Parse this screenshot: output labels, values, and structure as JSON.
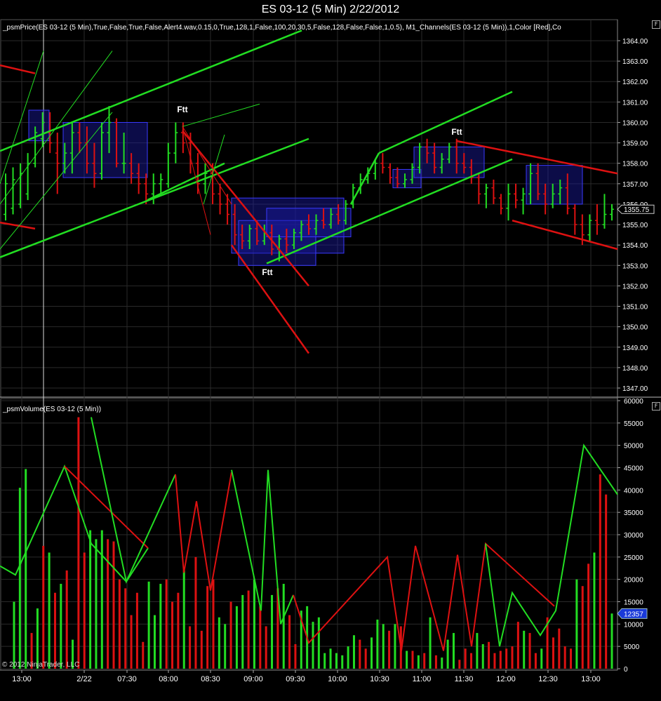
{
  "window": {
    "title": "ES 03-12 (5 Min)  2/22/2012"
  },
  "price_panel": {
    "indicator_label": "_psmPrice(ES 03-12 (5 Min),True,False,True,False,Alert4.wav,0.15,0,True,128,1,False,100,20,30,5,False,128,False,False,1,0.5), M1_Channels(ES 03-12 (5 Min)),1,Color [Red],Co",
    "f_button": "F",
    "current_price_tag": "1355.75",
    "ftt_markers": [
      {
        "text": "Ftt"
      },
      {
        "text": "Ftt"
      },
      {
        "text": "Ftt"
      }
    ]
  },
  "volume_panel": {
    "indicator_label": "_psmVolume(ES 03-12 (5 Min))",
    "f_button": "F",
    "current_volume_tag": "12357"
  },
  "copyright": "© 2012 NinjaTrader, LLC",
  "time_axis": {
    "labels": [
      "13:00",
      "2/22",
      "07:30",
      "08:00",
      "08:30",
      "09:00",
      "09:30",
      "10:00",
      "10:30",
      "11:00",
      "11:30",
      "12:00",
      "12:30",
      "13:00"
    ]
  },
  "colors": {
    "up": "#22dd22",
    "down": "#dd1111",
    "box": "#1a1aa0",
    "grid": "#2a2a2a",
    "axis_text": "#ffffff",
    "tag_blue": "#1a3ad8"
  },
  "chart_data": [
    {
      "type": "line",
      "title": "",
      "ylabel": "",
      "ylim": [
        1346.6,
        1364.4
      ],
      "y_ticks": [
        1347,
        1348,
        1349,
        1350,
        1351,
        1352,
        1353,
        1354,
        1355,
        1356,
        1357,
        1358,
        1359,
        1360,
        1361,
        1362,
        1363,
        1364
      ],
      "grid": true,
      "series": [
        {
          "values": [
            [
              1355.5,
              1357.5,
              1355.2,
              1357.0
            ],
            [
              1355.8,
              1357.8,
              1355.5,
              1357.2
            ],
            [
              1356.0,
              1358.0,
              1355.8,
              1357.5
            ],
            [
              1356.5,
              1358.5,
              1356.2,
              1358.0
            ],
            [
              1358.0,
              1359.8,
              1357.8,
              1359.5
            ],
            [
              1359.2,
              1360.5,
              1358.8,
              1360.0
            ],
            [
              1359.5,
              1360.5,
              1358.5,
              1359.0
            ],
            [
              1358.5,
              1359.5,
              1356.5,
              1358.0
            ],
            [
              1358.0,
              1359.0,
              1357.5,
              1358.5
            ],
            [
              1358.5,
              1360.0,
              1357.5,
              1359.5
            ],
            [
              1359.5,
              1360.0,
              1358.5,
              1359.0
            ],
            [
              1359.0,
              1359.8,
              1357.5,
              1358.0
            ],
            [
              1358.0,
              1359.0,
              1356.8,
              1357.5
            ],
            [
              1357.5,
              1360.0,
              1357.2,
              1359.5
            ],
            [
              1359.5,
              1360.8,
              1358.5,
              1360.0
            ],
            [
              1360.0,
              1360.2,
              1357.8,
              1358.0
            ],
            [
              1358.0,
              1359.5,
              1357.5,
              1358.0
            ],
            [
              1358.0,
              1358.5,
              1357.0,
              1357.5
            ],
            [
              1357.5,
              1358.0,
              1356.5,
              1357.0
            ],
            [
              1357.0,
              1357.5,
              1356.0,
              1356.5
            ],
            [
              1356.5,
              1357.5,
              1356.0,
              1357.0
            ],
            [
              1357.0,
              1357.5,
              1356.5,
              1357.2
            ],
            [
              1357.0,
              1359.0,
              1356.8,
              1358.5
            ],
            [
              1358.5,
              1360.0,
              1358.0,
              1359.5
            ],
            [
              1359.5,
              1360.0,
              1358.5,
              1359.0
            ],
            [
              1359.0,
              1359.5,
              1357.5,
              1358.0
            ],
            [
              1358.0,
              1358.5,
              1356.5,
              1357.0
            ],
            [
              1357.0,
              1358.0,
              1356.5,
              1357.5
            ],
            [
              1357.5,
              1358.0,
              1356.0,
              1356.5
            ],
            [
              1356.5,
              1357.0,
              1355.5,
              1356.0
            ],
            [
              1356.0,
              1356.5,
              1355.0,
              1355.5
            ],
            [
              1355.5,
              1356.0,
              1354.0,
              1354.5
            ],
            [
              1354.5,
              1355.0,
              1353.8,
              1354.2
            ],
            [
              1354.2,
              1355.0,
              1353.8,
              1354.8
            ],
            [
              1354.8,
              1355.2,
              1354.0,
              1354.2
            ],
            [
              1354.2,
              1355.0,
              1354.0,
              1354.6
            ],
            [
              1354.6,
              1355.0,
              1353.5,
              1353.8
            ],
            [
              1353.8,
              1354.5,
              1353.2,
              1354.3
            ],
            [
              1354.3,
              1354.8,
              1353.6,
              1354.0
            ],
            [
              1354.0,
              1354.8,
              1353.8,
              1354.6
            ],
            [
              1354.6,
              1355.2,
              1354.2,
              1355.0
            ],
            [
              1355.0,
              1355.5,
              1354.5,
              1354.8
            ],
            [
              1354.8,
              1355.5,
              1354.5,
              1355.2
            ],
            [
              1355.2,
              1355.8,
              1354.8,
              1355.0
            ],
            [
              1355.0,
              1355.8,
              1354.8,
              1355.5
            ],
            [
              1355.5,
              1356.0,
              1355.0,
              1355.2
            ],
            [
              1355.2,
              1356.2,
              1355.0,
              1356.0
            ],
            [
              1356.0,
              1357.0,
              1355.8,
              1356.8
            ],
            [
              1356.8,
              1357.5,
              1356.5,
              1357.2
            ],
            [
              1357.2,
              1357.8,
              1357.0,
              1357.5
            ],
            [
              1357.5,
              1358.2,
              1357.2,
              1358.0
            ],
            [
              1358.0,
              1358.5,
              1357.5,
              1357.8
            ],
            [
              1357.8,
              1358.0,
              1357.0,
              1357.3
            ],
            [
              1357.3,
              1357.8,
              1356.8,
              1357.0
            ],
            [
              1357.0,
              1357.5,
              1356.8,
              1357.2
            ],
            [
              1357.2,
              1358.0,
              1357.0,
              1357.8
            ],
            [
              1357.8,
              1359.0,
              1357.5,
              1358.8
            ],
            [
              1358.8,
              1359.2,
              1358.0,
              1358.5
            ],
            [
              1358.5,
              1359.0,
              1357.5,
              1357.8
            ],
            [
              1357.8,
              1358.5,
              1357.5,
              1358.2
            ],
            [
              1358.2,
              1359.0,
              1358.0,
              1358.8
            ],
            [
              1358.8,
              1359.2,
              1357.5,
              1358.0
            ],
            [
              1358.0,
              1358.5,
              1357.5,
              1357.8
            ],
            [
              1357.8,
              1358.2,
              1357.0,
              1357.3
            ],
            [
              1357.3,
              1357.5,
              1356.0,
              1356.5
            ],
            [
              1356.5,
              1357.0,
              1355.8,
              1356.8
            ],
            [
              1356.8,
              1357.2,
              1356.0,
              1356.3
            ],
            [
              1356.3,
              1356.5,
              1355.5,
              1355.8
            ],
            [
              1355.8,
              1357.0,
              1355.2,
              1356.5
            ],
            [
              1356.5,
              1357.0,
              1355.8,
              1356.2
            ],
            [
              1356.2,
              1356.8,
              1355.5,
              1356.5
            ],
            [
              1356.5,
              1358.0,
              1356.0,
              1357.5
            ],
            [
              1357.5,
              1358.0,
              1356.2,
              1356.5
            ],
            [
              1356.5,
              1357.0,
              1355.5,
              1356.0
            ],
            [
              1356.0,
              1357.0,
              1355.8,
              1356.5
            ],
            [
              1356.5,
              1357.2,
              1356.0,
              1356.8
            ],
            [
              1356.8,
              1357.5,
              1355.5,
              1355.8
            ],
            [
              1355.8,
              1356.0,
              1354.5,
              1355.0
            ],
            [
              1355.0,
              1355.5,
              1354.0,
              1354.5
            ],
            [
              1354.5,
              1355.5,
              1354.2,
              1355.2
            ],
            [
              1355.2,
              1356.0,
              1354.5,
              1355.0
            ],
            [
              1355.0,
              1356.5,
              1354.8,
              1355.5
            ],
            [
              1355.5,
              1356.0,
              1355.2,
              1355.75
            ]
          ]
        }
      ],
      "channel_lines": [
        {
          "color": "up",
          "x1": 0,
          "y1": 1358.6,
          "x2": 430,
          "y2": 1364.5
        },
        {
          "color": "up",
          "x1": 0,
          "y1": 1353.4,
          "x2": 440,
          "y2": 1359.2
        },
        {
          "color": "up",
          "x1": 210,
          "y1": 1356.2,
          "x2": 320,
          "y2": 1358.0
        },
        {
          "color": "up",
          "x1": 540,
          "y1": 1358.5,
          "x2": 730,
          "y2": 1361.5
        },
        {
          "color": "up",
          "x1": 380,
          "y1": 1353.1,
          "x2": 730,
          "y2": 1358.2
        },
        {
          "color": "up",
          "x1": 500,
          "y1": 1356.0,
          "x2": 540,
          "y2": 1358.5
        },
        {
          "color": "down",
          "x1": 0,
          "y1": 1362.8,
          "x2": 50,
          "y2": 1362.4
        },
        {
          "color": "down",
          "x1": 0,
          "y1": 1355.1,
          "x2": 50,
          "y2": 1354.8
        },
        {
          "color": "down",
          "x1": 260,
          "y1": 1359.6,
          "x2": 440,
          "y2": 1352.0
        },
        {
          "color": "down",
          "x1": 330,
          "y1": 1354.0,
          "x2": 440,
          "y2": 1348.7
        },
        {
          "color": "down",
          "x1": 650,
          "y1": 1359.1,
          "x2": 880,
          "y2": 1357.5
        },
        {
          "color": "down",
          "x1": 730,
          "y1": 1355.2,
          "x2": 880,
          "y2": 1353.8
        }
      ],
      "boxes": [
        {
          "x1": 41,
          "x2": 70,
          "y1": 1359.1,
          "y2": 1360.6
        },
        {
          "x1": 90,
          "x2": 210,
          "y1": 1357.3,
          "y2": 1360.0
        },
        {
          "x1": 330,
          "x2": 490,
          "y1": 1353.6,
          "y2": 1356.3
        },
        {
          "x1": 340,
          "x2": 450,
          "y1": 1353.0,
          "y2": 1355.2
        },
        {
          "x1": 380,
          "x2": 500,
          "y1": 1354.4,
          "y2": 1355.8
        },
        {
          "x1": 560,
          "x2": 600,
          "y1": 1356.8,
          "y2": 1357.7
        },
        {
          "x1": 590,
          "x2": 690,
          "y1": 1357.3,
          "y2": 1358.8
        },
        {
          "x1": 750,
          "x2": 830,
          "y1": 1356.0,
          "y2": 1357.9
        }
      ]
    },
    {
      "type": "bar",
      "title": "",
      "ylabel": "",
      "ylim": [
        0,
        60000
      ],
      "y_ticks": [
        0,
        5000,
        10000,
        15000,
        20000,
        25000,
        30000,
        35000,
        40000,
        45000,
        50000,
        55000,
        60000
      ],
      "grid": true,
      "values": [
        15000,
        40500,
        44700,
        8000,
        13500,
        27500,
        26000,
        17000,
        19000,
        22000,
        6500,
        56300,
        26000,
        31000,
        29000,
        31000,
        29000,
        28500,
        20000,
        18000,
        12000,
        17000,
        6000,
        19500,
        12000,
        19000,
        20000,
        15000,
        17000,
        22000,
        9500,
        25000,
        8500,
        18500,
        20000,
        11500,
        10000,
        15000,
        14000,
        16500,
        17500,
        20000,
        14000,
        9500,
        16500,
        18000,
        19000,
        12000,
        5500,
        13000,
        14000,
        10500,
        11500,
        3500,
        4500,
        3500,
        3000,
        5000,
        7500,
        6500,
        4500,
        7000,
        11000,
        10000,
        8500,
        10000,
        9500,
        4000,
        4000,
        3000,
        3500,
        11500,
        3000,
        2500,
        6500,
        8000,
        2000,
        4500,
        3500,
        8000,
        5500,
        6000,
        3500,
        4000,
        4500,
        5000,
        10500,
        8500,
        8000,
        3500,
        4500,
        11500,
        7000,
        9000,
        5000,
        4500,
        20000,
        18500,
        23500,
        26000,
        43500,
        39000,
        12357
      ],
      "directions": "gggrgrgrgrgrrgggrrrrrrrgggrrrgrrrrrggrggrgrrgrgrrggggggggggrrgggrgrgrgrgrgggrrrggrrrrrrgrrgrrrrrgrrgrrgg",
      "volume_lines": [
        {
          "color": "up",
          "points": [
            [
              0,
              23000
            ],
            [
              22,
              21000
            ],
            [
              92,
              45300
            ],
            [
              130,
              28000
            ],
            [
              180,
              19500
            ],
            [
              211,
              27000
            ]
          ]
        },
        {
          "color": "down",
          "points": [
            [
              92,
              45300
            ],
            [
              211,
              27000
            ]
          ]
        },
        {
          "color": "up",
          "points": [
            [
              130,
              56300
            ],
            [
              180,
              19500
            ],
            [
              250,
              43500
            ]
          ]
        },
        {
          "color": "down",
          "points": [
            [
              250,
              43500
            ],
            [
              262,
              21500
            ],
            [
              280,
              37500
            ],
            [
              300,
              17500
            ],
            [
              330,
              44000
            ]
          ]
        },
        {
          "color": "up",
          "points": [
            [
              330,
              44500
            ],
            [
              372,
              13000
            ],
            [
              382,
              44500
            ],
            [
              400,
              10000
            ],
            [
              418,
              16500
            ]
          ]
        },
        {
          "color": "down",
          "points": [
            [
              418,
              16500
            ],
            [
              440,
              5800
            ],
            [
              552,
              25000
            ],
            [
              572,
              4000
            ],
            [
              592,
              27500
            ],
            [
              632,
              4000
            ],
            [
              652,
              25500
            ],
            [
              672,
              5000
            ],
            [
              692,
              28000
            ],
            [
              790,
              14000
            ]
          ]
        },
        {
          "color": "up",
          "points": [
            [
              692,
              28000
            ],
            [
              712,
              5000
            ],
            [
              730,
              17000
            ],
            [
              770,
              7500
            ],
            [
              792,
              13000
            ],
            [
              832,
              50000
            ],
            [
              880,
              39000
            ]
          ]
        }
      ]
    }
  ]
}
